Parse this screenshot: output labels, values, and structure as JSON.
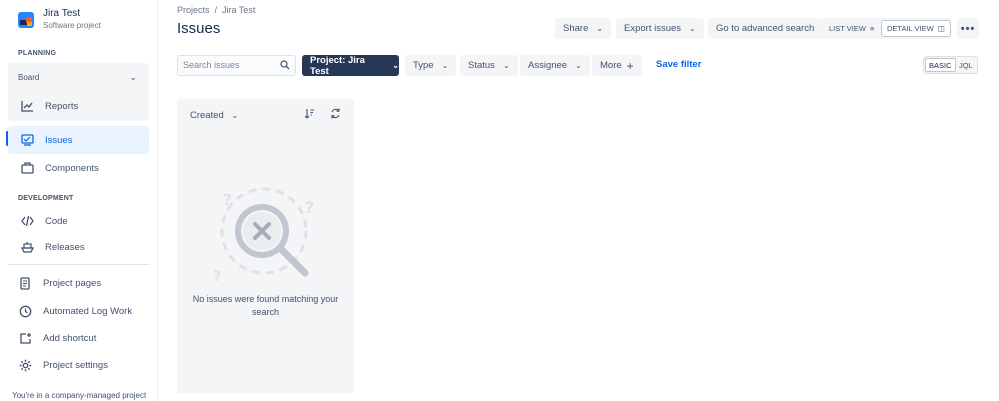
{
  "project": {
    "name": "Jira Test",
    "type": "Software project"
  },
  "sidebar": {
    "planning_label": "PLANNING",
    "board_label": "Board",
    "development_label": "DEVELOPMENT",
    "items": [
      {
        "label": "Reports",
        "icon": "chart-line-icon"
      },
      {
        "label": "Issues",
        "icon": "issues-icon",
        "active": true
      },
      {
        "label": "Components",
        "icon": "components-icon"
      },
      {
        "label": "Code",
        "icon": "code-icon"
      },
      {
        "label": "Releases",
        "icon": "ship-icon"
      },
      {
        "label": "Project pages",
        "icon": "page-icon"
      },
      {
        "label": "Automated Log Work",
        "icon": "clock-icon"
      },
      {
        "label": "Add shortcut",
        "icon": "add-shortcut-icon"
      },
      {
        "label": "Project settings",
        "icon": "gear-icon"
      }
    ],
    "footer_note": "You're in a company-managed project"
  },
  "breadcrumb": {
    "projects": "Projects",
    "separator": "/",
    "current": "Jira Test"
  },
  "page_title": "Issues",
  "header_buttons": {
    "share": "Share",
    "export": "Export issues",
    "advanced_search": "Go to advanced search",
    "list_view": "LIST VIEW",
    "detail_view": "DETAIL VIEW"
  },
  "filters": {
    "search_placeholder": "Search issues",
    "project": "Project: Jira Test",
    "type": "Type",
    "status": "Status",
    "assignee": "Assignee",
    "more": "More",
    "save_filter": "Save filter",
    "basic": "BASIC",
    "jql": "JQL"
  },
  "list_panel": {
    "sort_by": "Created",
    "empty_message": "No issues were found matching your search"
  },
  "colors": {
    "accent": "#0C66E4",
    "project_filter_bg": "#253858",
    "panel_bg": "#F4F5F7"
  }
}
